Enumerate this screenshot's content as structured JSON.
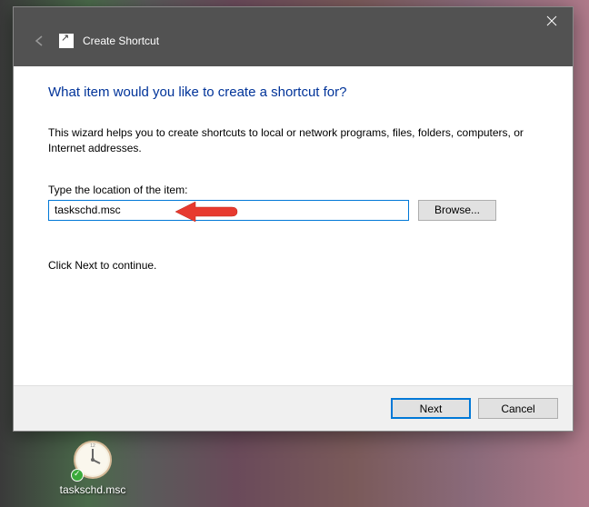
{
  "dialog": {
    "title": "Create Shortcut",
    "heading": "What item would you like to create a shortcut for?",
    "description": "This wizard helps you to create shortcuts to local or network programs, files, folders, computers, or Internet addresses.",
    "input_label": "Type the location of the item:",
    "input_value": "taskschd.msc",
    "browse_label": "Browse...",
    "continue_text": "Click Next to continue.",
    "next_label": "Next",
    "cancel_label": "Cancel"
  },
  "desktop": {
    "shortcut_name": "taskschd.msc"
  }
}
